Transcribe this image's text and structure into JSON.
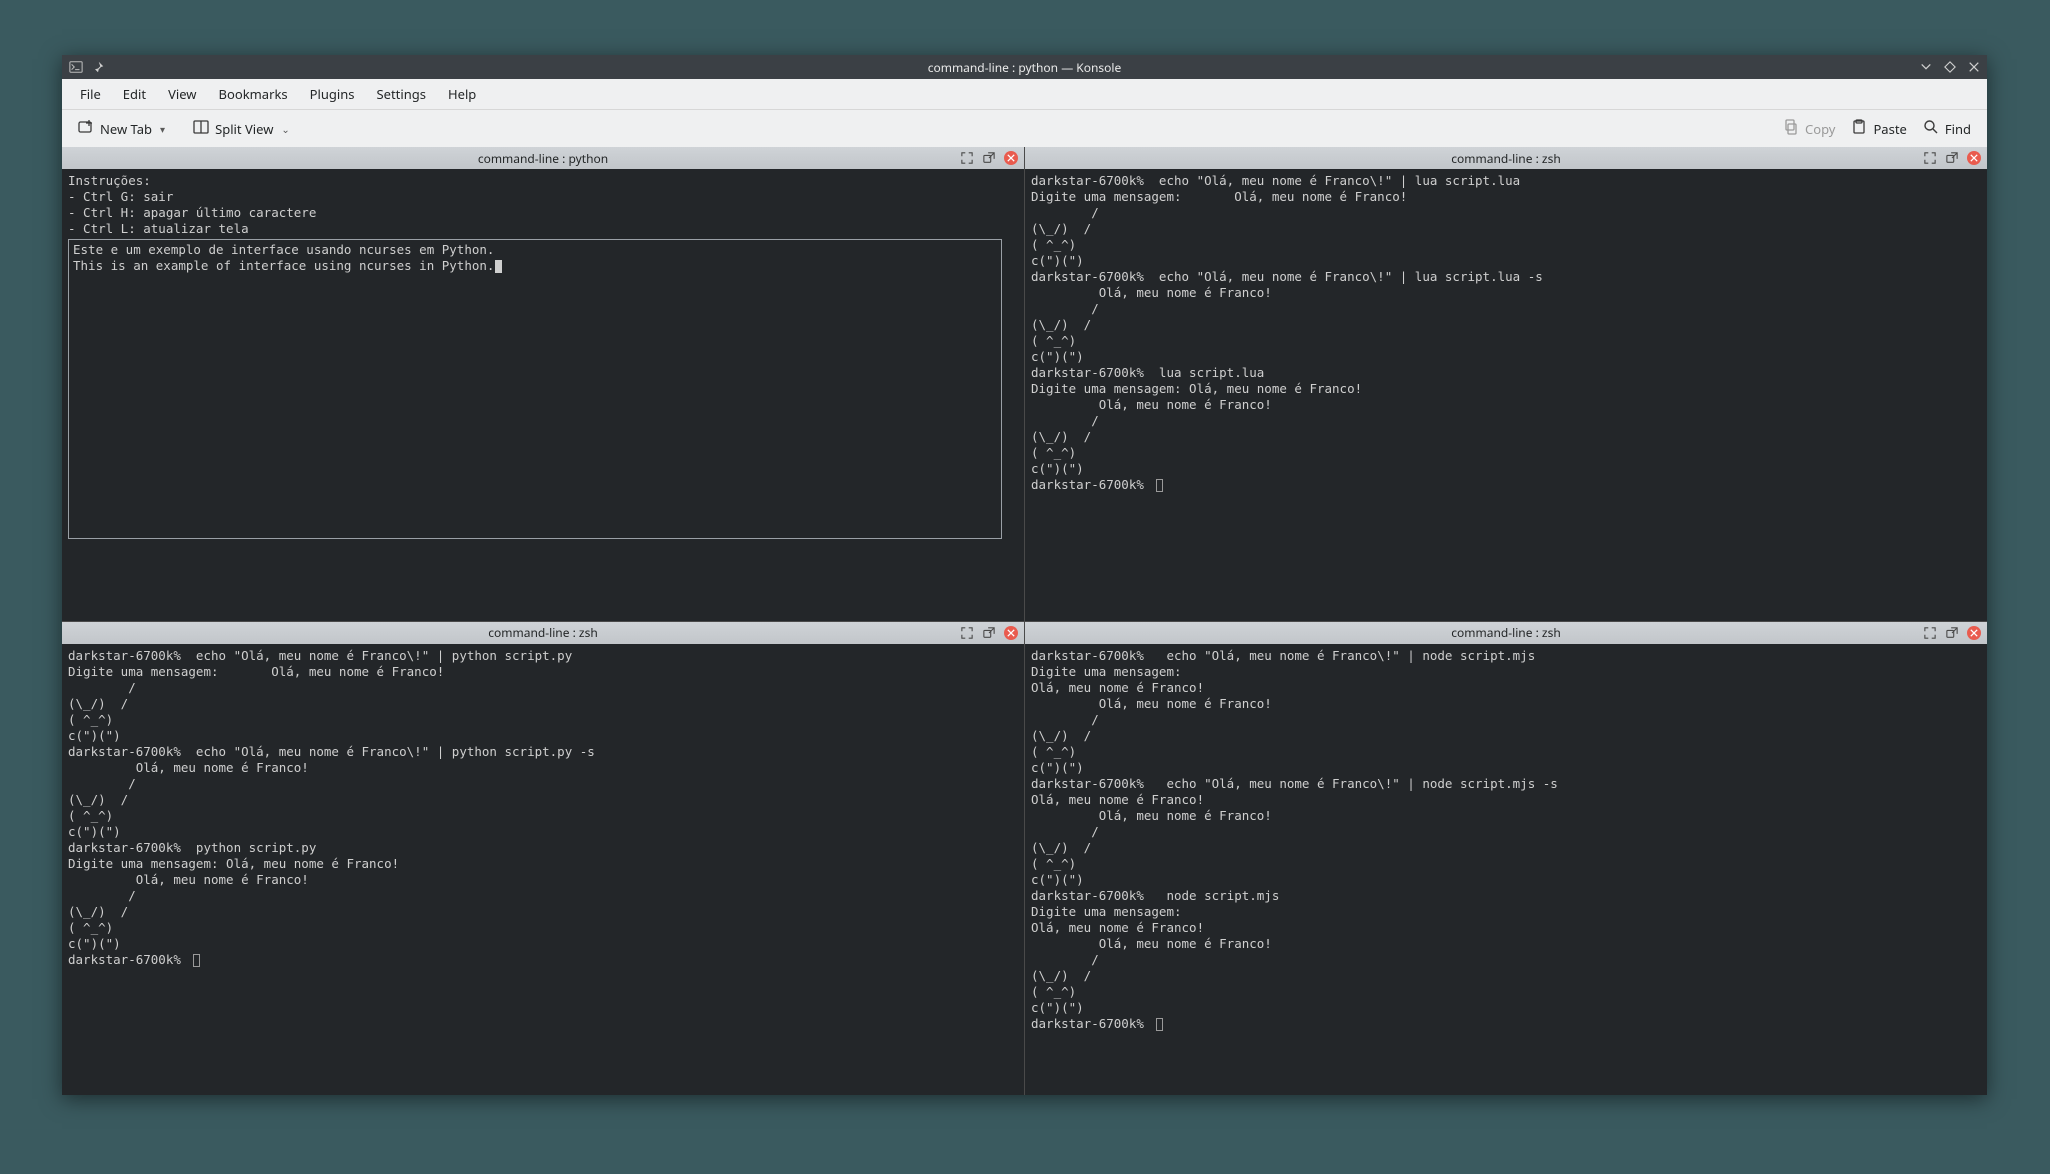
{
  "window": {
    "title": "command-line : python — Konsole"
  },
  "menubar": [
    "File",
    "Edit",
    "View",
    "Bookmarks",
    "Plugins",
    "Settings",
    "Help"
  ],
  "toolbar": {
    "new_tab": "New Tab",
    "split_view": "Split View",
    "copy": "Copy",
    "paste": "Paste",
    "find": "Find"
  },
  "panes": [
    {
      "title": "command-line : python",
      "type": "ncurses",
      "header_lines": [
        "Instruções:",
        "- Ctrl G: sair",
        "- Ctrl H: apagar último caractere",
        "- Ctrl L: atualizar tela"
      ],
      "box_lines": [
        "Este e um exemplo de interface usando ncurses em Python.",
        "This is an example of interface using ncurses in Python."
      ]
    },
    {
      "title": "command-line : zsh",
      "type": "plain",
      "lines": [
        "darkstar-6700k%  echo \"Olá, meu nome é Franco\\!\" | lua script.lua",
        "Digite uma mensagem:       Olá, meu nome é Franco!",
        "        /",
        "(\\_/)  /",
        "( ^_^)",
        "c(\")(\")",
        "darkstar-6700k%  echo \"Olá, meu nome é Franco\\!\" | lua script.lua -s",
        "         Olá, meu nome é Franco!",
        "        /",
        "(\\_/)  /",
        "( ^_^)",
        "c(\")(\")",
        "darkstar-6700k%  lua script.lua",
        "Digite uma mensagem: Olá, meu nome é Franco!",
        "         Olá, meu nome é Franco!",
        "        /",
        "(\\_/)  /",
        "( ^_^)",
        "c(\")(\")",
        "darkstar-6700k% "
      ]
    },
    {
      "title": "command-line : zsh",
      "type": "plain",
      "lines": [
        "darkstar-6700k%  echo \"Olá, meu nome é Franco\\!\" | python script.py",
        "Digite uma mensagem:       Olá, meu nome é Franco!",
        "        /",
        "(\\_/)  /",
        "( ^_^)",
        "c(\")(\")",
        "darkstar-6700k%  echo \"Olá, meu nome é Franco\\!\" | python script.py -s",
        "         Olá, meu nome é Franco!",
        "        /",
        "(\\_/)  /",
        "( ^_^)",
        "c(\")(\")",
        "darkstar-6700k%  python script.py",
        "Digite uma mensagem: Olá, meu nome é Franco!",
        "         Olá, meu nome é Franco!",
        "        /",
        "(\\_/)  /",
        "( ^_^)",
        "c(\")(\")",
        "darkstar-6700k% "
      ]
    },
    {
      "title": "command-line : zsh",
      "type": "plain",
      "lines": [
        "darkstar-6700k%   echo \"Olá, meu nome é Franco\\!\" | node script.mjs",
        "Digite uma mensagem:",
        "Olá, meu nome é Franco!",
        "         Olá, meu nome é Franco!",
        "        /",
        "(\\_/)  /",
        "( ^_^)",
        "c(\")(\")",
        "darkstar-6700k%   echo \"Olá, meu nome é Franco\\!\" | node script.mjs -s",
        "Olá, meu nome é Franco!",
        "         Olá, meu nome é Franco!",
        "        /",
        "(\\_/)  /",
        "( ^_^)",
        "c(\")(\")",
        "darkstar-6700k%   node script.mjs",
        "Digite uma mensagem:",
        "Olá, meu nome é Franco!",
        "         Olá, meu nome é Franco!",
        "        /",
        "(\\_/)  /",
        "( ^_^)",
        "c(\")(\")",
        "darkstar-6700k% "
      ]
    }
  ]
}
